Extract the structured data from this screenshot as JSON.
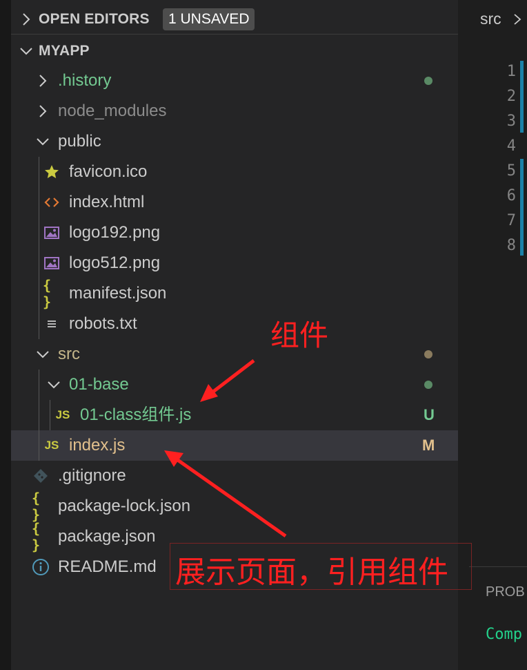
{
  "open_editors": {
    "title": "OPEN EDITORS",
    "badge": "1 UNSAVED"
  },
  "project": {
    "title": "MYAPP"
  },
  "tree": [
    {
      "label": ".history",
      "color": "#73c991",
      "status_dot": "#5a8a65"
    },
    {
      "label": "node_modules",
      "color": "#8c8c8c"
    },
    {
      "label": "public",
      "color": "#cccccc"
    },
    {
      "label": "favicon.ico",
      "color": "#cccccc",
      "icon": "star-icon"
    },
    {
      "label": "index.html",
      "color": "#cccccc",
      "icon": "html-code-icon"
    },
    {
      "label": "logo192.png",
      "color": "#cccccc",
      "icon": "image-icon"
    },
    {
      "label": "logo512.png",
      "color": "#cccccc",
      "icon": "image-icon"
    },
    {
      "label": "manifest.json",
      "color": "#cccccc",
      "icon": "json-braces-icon",
      "icon_text": "{ }"
    },
    {
      "label": "robots.txt",
      "color": "#cccccc",
      "icon": "text-lines-icon"
    },
    {
      "label": "src",
      "color": "#c4b68a",
      "status_dot": "#8a7b5e"
    },
    {
      "label": "01-base",
      "color": "#73c991",
      "status_dot": "#5a8a65"
    },
    {
      "label": "01-class组件.js",
      "color": "#73c991",
      "icon": "js-file-icon",
      "icon_text": "JS",
      "status": "U",
      "status_color": "#73c991"
    },
    {
      "label": "index.js",
      "color": "#e2c08d",
      "icon": "js-file-icon",
      "icon_text": "JS",
      "status": "M",
      "status_color": "#e2c08d"
    },
    {
      "label": ".gitignore",
      "color": "#cccccc",
      "icon": "git-diamond-icon"
    },
    {
      "label": "package-lock.json",
      "color": "#cccccc",
      "icon": "json-braces-icon",
      "icon_text": "{ }"
    },
    {
      "label": "package.json",
      "color": "#cccccc",
      "icon": "json-braces-icon",
      "icon_text": "{ }"
    },
    {
      "label": "README.md",
      "color": "#cccccc",
      "icon": "info-icon"
    }
  ],
  "editor": {
    "breadcrumb": "src",
    "line_numbers": [
      "1",
      "2",
      "3",
      "4",
      "5",
      "6",
      "7",
      "8"
    ],
    "panel_tab": "PROB",
    "panel_text": "Comp"
  },
  "annotations": {
    "component": "组件",
    "page": "展示页面，引用组件",
    "color": "#ff2020"
  }
}
